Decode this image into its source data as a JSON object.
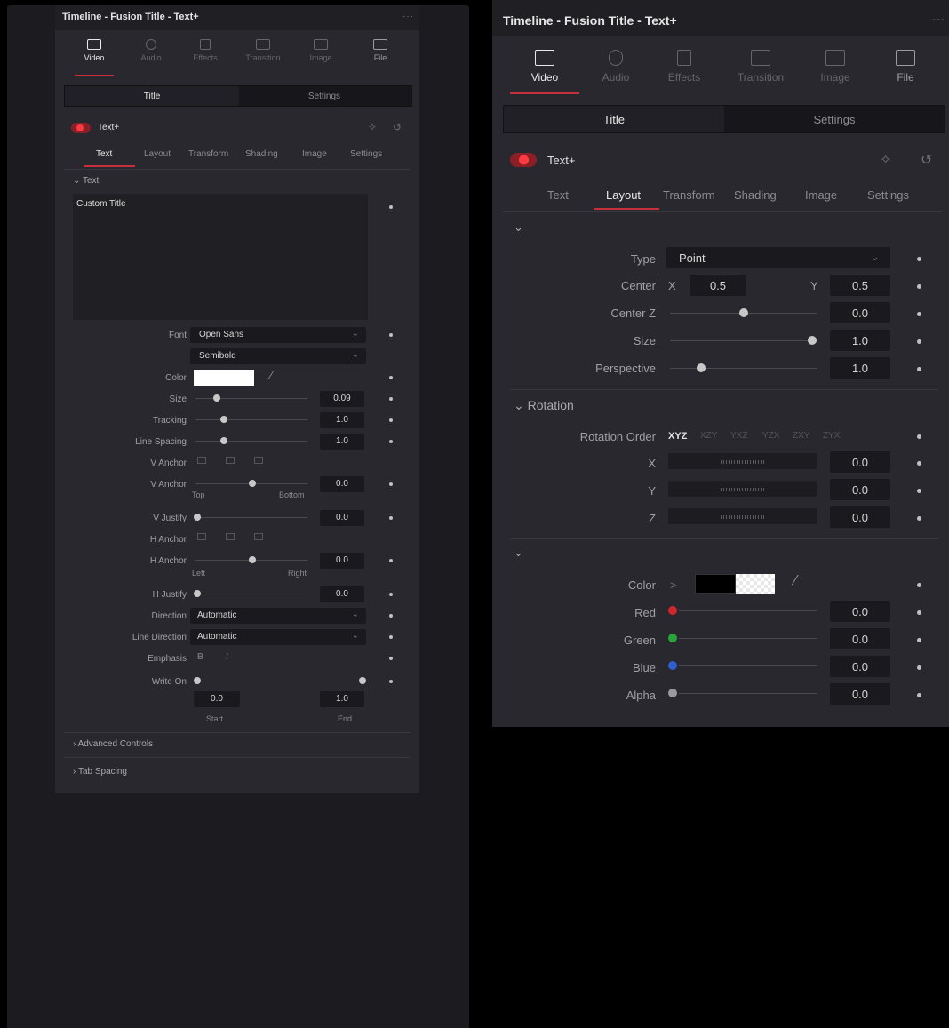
{
  "panel_title": "Timeline - Fusion Title - Text+",
  "more": "···",
  "tabs": [
    "Video",
    "Audio",
    "Effects",
    "Transition",
    "Image",
    "File"
  ],
  "segment": {
    "title": "Title",
    "settings": "Settings"
  },
  "tool": {
    "name": "Text+"
  },
  "subtabs": [
    "Text",
    "Layout",
    "Transform",
    "Shading",
    "Image",
    "Settings"
  ],
  "left": {
    "section_text": "Text",
    "text_value": "Custom Title",
    "font_label": "Font",
    "font": "Open Sans",
    "style": "Semibold",
    "color_label": "Color",
    "size_label": "Size",
    "size": "0.09",
    "tracking_label": "Tracking",
    "tracking": "1.0",
    "line_spacing_label": "Line Spacing",
    "line_spacing": "1.0",
    "v_anchor_label": "V Anchor",
    "v_anchor_label2": "V Anchor",
    "v_anchor": "0.0",
    "top": "Top",
    "bottom": "Bottom",
    "v_justify_label": "V Justify",
    "v_justify": "0.0",
    "h_anchor_label": "H Anchor",
    "h_anchor_label2": "H Anchor",
    "h_anchor": "0.0",
    "left": "Left",
    "right": "Right",
    "h_justify_label": "H Justify",
    "h_justify": "0.0",
    "direction_label": "Direction",
    "direction": "Automatic",
    "line_direction_label": "Line Direction",
    "line_direction": "Automatic",
    "emphasis_label": "Emphasis",
    "write_on_label": "Write On",
    "start": "0.0",
    "end": "1.0",
    "start_label": "Start",
    "end_label": "End",
    "advanced": "Advanced Controls",
    "tab_spacing": "Tab Spacing"
  },
  "right": {
    "type_label": "Type",
    "type": "Point",
    "center_label": "Center",
    "x_label": "X",
    "center_x": "0.5",
    "y_label": "Y",
    "center_y": "0.5",
    "center_z_label": "Center Z",
    "center_z": "0.0",
    "size_label": "Size",
    "size": "1.0",
    "perspective_label": "Perspective",
    "perspective": "1.0",
    "rotation_section": "Rotation",
    "rotation_order_label": "Rotation Order",
    "rotation_orders": [
      "XYZ",
      "XZY",
      "YXZ",
      "YZX",
      "ZXY",
      "ZYX"
    ],
    "rx_label": "X",
    "rx": "0.0",
    "ry_label": "Y",
    "ry": "0.0",
    "rz_label": "Z",
    "rz": "0.0",
    "color_label": "Color",
    "color_arrow": ">",
    "red_label": "Red",
    "red": "0.0",
    "green_label": "Green",
    "green": "0.0",
    "blue_label": "Blue",
    "blue": "0.0",
    "alpha_label": "Alpha",
    "alpha": "0.0"
  },
  "colors": {
    "accent": "#c6303b",
    "panel": "#28282e",
    "field": "#1a1a1e"
  }
}
